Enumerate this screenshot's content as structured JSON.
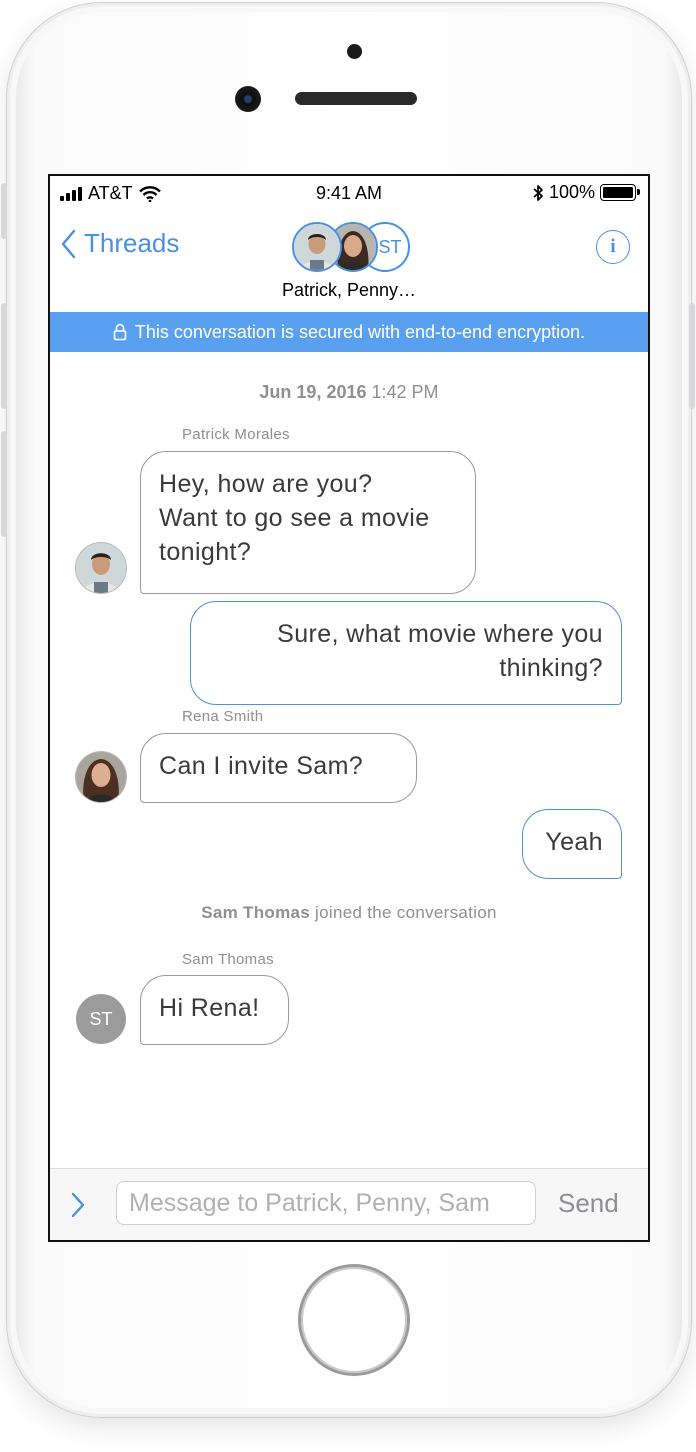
{
  "status_bar": {
    "carrier": "AT&T",
    "time": "9:41 AM",
    "battery": "100%"
  },
  "nav": {
    "back_label": "Threads",
    "avatar_initials": "ST",
    "participants": "Patrick, Penny…",
    "info_icon": "i"
  },
  "banner": {
    "text": "This conversation is secured with end-to-end encryption."
  },
  "conversation": {
    "date_bold": "Jun 19, 2016",
    "date_time": "1:42 PM",
    "messages": [
      {
        "sender": "Patrick Morales",
        "direction": "incoming",
        "lines": [
          "Hey, how are you?",
          "Want to go see a movie",
          "tonight?"
        ]
      },
      {
        "direction": "outgoing",
        "lines": [
          "Sure, what movie where you",
          "thinking?"
        ]
      },
      {
        "sender": "Rena Smith",
        "direction": "incoming",
        "lines": [
          "Can I invite Sam?"
        ]
      },
      {
        "direction": "outgoing",
        "lines": [
          "Yeah"
        ]
      },
      {
        "sender": "Sam Thomas",
        "direction": "incoming",
        "lines": [
          "Hi Rena!"
        ],
        "avatar_initials": "ST"
      }
    ],
    "system_event": {
      "name": "Sam Thomas",
      "text": "joined the conversation"
    }
  },
  "composer": {
    "placeholder": "Message to Patrick, Penny, Sam",
    "send_label": "Send"
  },
  "colors": {
    "accent": "#4a90e2",
    "banner": "#5aa0f0",
    "muted_text": "#8e8e93"
  },
  "icons": [
    "back-chevron-icon",
    "info-icon",
    "lock-icon",
    "bluetooth-icon",
    "wifi-icon",
    "signal-icon",
    "battery-icon",
    "expand-chevron-icon"
  ]
}
